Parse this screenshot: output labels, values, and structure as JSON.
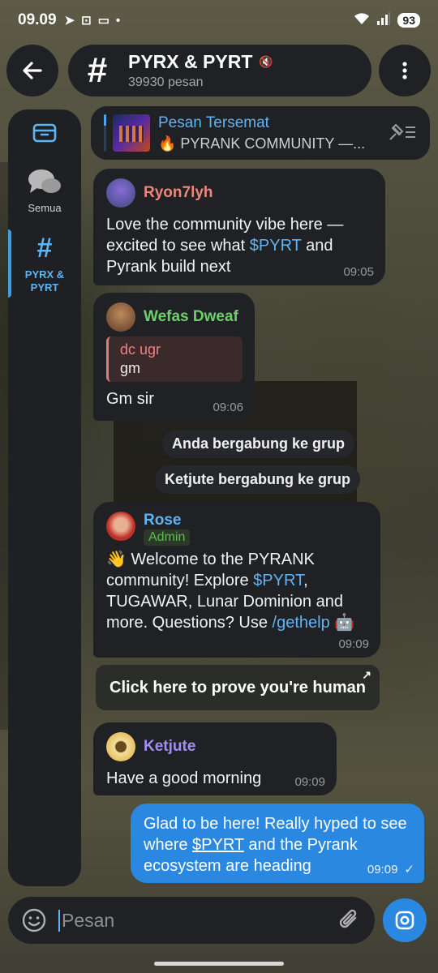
{
  "status_bar": {
    "time": "09.09",
    "battery": "93"
  },
  "colors": {
    "accent": "#2a88e0",
    "link": "#5fb4f4",
    "bubble": "#202124"
  },
  "header": {
    "title": "PYRX & PYRT",
    "subtitle": "39930 pesan",
    "back_icon": "arrow-left-icon",
    "menu_icon": "more-vertical-icon"
  },
  "sidebar": {
    "items": [
      {
        "label": "",
        "icon": "archive-icon"
      },
      {
        "label": "Semua",
        "icon": "chats-icon"
      },
      {
        "label": "PYRX & PYRT",
        "icon": "hash-icon"
      }
    ]
  },
  "pinned": {
    "title": "Pesan Tersemat",
    "text": "🔥 PYRANK COMMUNITY —..."
  },
  "messages": [
    {
      "sender": "Ryon7lyh",
      "color": "#f0867a",
      "parts": [
        "Love the community vibe here — excited to see what ",
        "$PYRT",
        " and Pyrank build next"
      ],
      "time": "09:05"
    },
    {
      "sender": "Wefas Dweaf",
      "color": "#6fcf6a",
      "quote_name": "dc ugr",
      "quote_text": "gm",
      "text": "Gm sir",
      "time": "09:06"
    },
    {
      "sender": "Rose",
      "color": "#5fb4f4",
      "badge": "Admin",
      "parts": [
        "👋 Welcome to the PYRANK community! Explore ",
        "$PYRT",
        ", TUGAWAR, Lunar Dominion and more. Questions? Use ",
        "/gethelp",
        " 🤖"
      ],
      "time": "09:09"
    },
    {
      "sender": "Ketjute",
      "color": "#a08ff0",
      "text": "Have a good morning",
      "time": "09:09"
    }
  ],
  "service": [
    "Anda bergabung ke grup",
    "Ketjute bergabung ke grup"
  ],
  "inline_button": "Click here to prove you're human",
  "outgoing": {
    "parts": [
      "Glad to be here! Really hyped to see where ",
      "$PYRT",
      " and the Pyrank ecosystem are heading"
    ],
    "time": "09:09"
  },
  "composer": {
    "placeholder": "Pesan"
  }
}
